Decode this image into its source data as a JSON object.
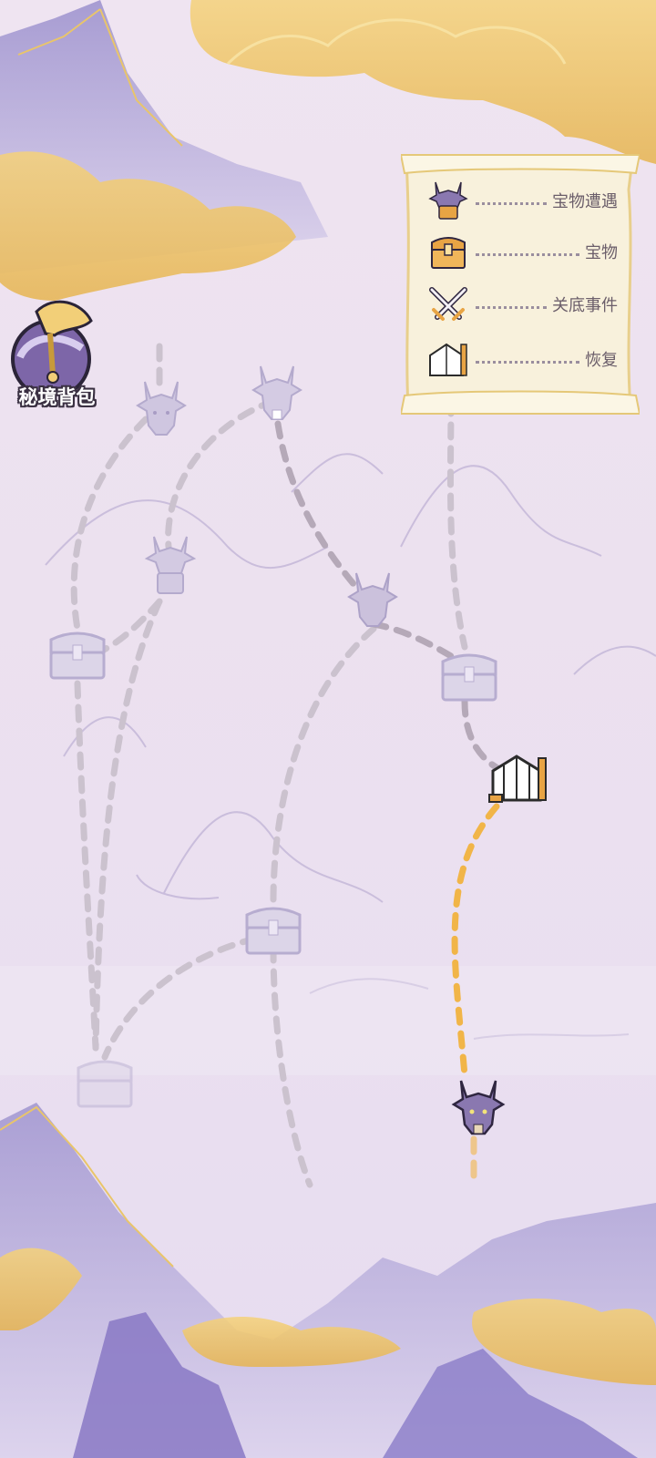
{
  "bag": {
    "label": "秘境背包",
    "icon": "bag-icon"
  },
  "legend": {
    "items": [
      {
        "icon": "dragon-treasure-icon",
        "label": "宝物遭遇"
      },
      {
        "icon": "treasure-chest-icon",
        "label": "宝物"
      },
      {
        "icon": "crossed-swords-icon",
        "label": "关底事件"
      },
      {
        "icon": "tent-icon",
        "label": "恢复"
      }
    ]
  },
  "map": {
    "nodes": [
      {
        "id": "dragon-1",
        "type": "dragon",
        "state": "locked"
      },
      {
        "id": "dragon-2",
        "type": "dragon",
        "state": "locked"
      },
      {
        "id": "dragon-treasure-1",
        "type": "dragon-treasure",
        "state": "locked"
      },
      {
        "id": "dragon-3",
        "type": "dragon",
        "state": "locked"
      },
      {
        "id": "chest-1",
        "type": "chest",
        "state": "locked"
      },
      {
        "id": "chest-2",
        "type": "chest",
        "state": "locked"
      },
      {
        "id": "tent-1",
        "type": "tent",
        "state": "available"
      },
      {
        "id": "chest-3",
        "type": "chest",
        "state": "locked"
      },
      {
        "id": "chest-4",
        "type": "chest",
        "state": "locked"
      },
      {
        "id": "dragon-current",
        "type": "dragon",
        "state": "current"
      }
    ]
  },
  "colors": {
    "gold": "#e8b74e",
    "path": "#c9c0cc",
    "active_path": "#f0b34a",
    "dragon": "#8a78b0"
  }
}
